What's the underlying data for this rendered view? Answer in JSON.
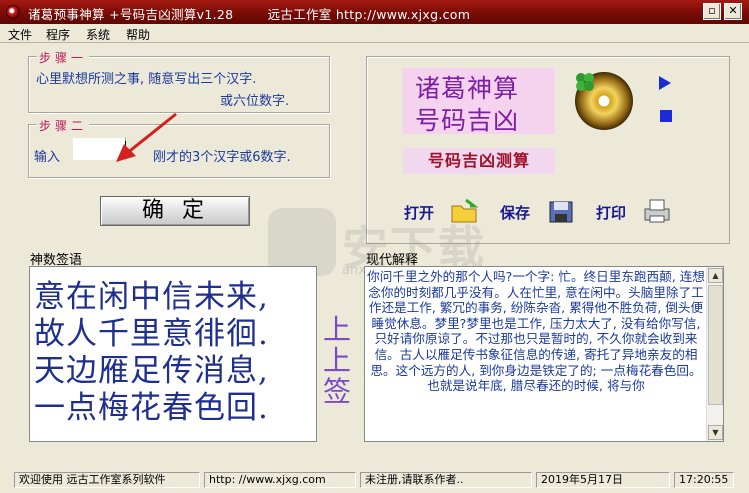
{
  "window": {
    "title": "诸葛预事神算 +号码吉凶测算v1.28        远古工作室 http://www.xjxg.com",
    "min_label": "▫",
    "close_label": "✕"
  },
  "menu": [
    "文件",
    "程序",
    "系统",
    "帮助"
  ],
  "step1": {
    "legend": "步骤一",
    "line1": "心里默想所测之事, 随意写出三个汉字.",
    "line2": "或六位数字."
  },
  "step2": {
    "legend": "步骤二",
    "input_label": "输入",
    "input_value": "",
    "hint": "刚才的3个汉字或6数字."
  },
  "ok_button": "确定",
  "logo": {
    "line1": "诸葛神算",
    "line2": "号码吉凶"
  },
  "sub_title": "号码吉凶测算",
  "tools": {
    "open": "打开",
    "save": "保存",
    "print": "打印"
  },
  "poem": {
    "label": "神数签语",
    "lines": [
      "意在闲中信未来,",
      "故人千里意徘徊.",
      "天边雁足传消息,",
      "一点梅花春色回."
    ],
    "lot": [
      "上",
      "上",
      "签"
    ]
  },
  "explanation": {
    "label": "现代解释",
    "text": "你问千里之外的那个人吗?一个字: 忙。终日里东跑西颠, 连想念你的时刻都几乎没有。人在忙里, 意在闲中。头脑里除了工作还是工作, 繁冗的事务, 纷陈杂沓, 累得他不胜负荷, 倒头便睡觉休息。梦里?梦里也是工作, 压力太大了, 没有给你写信, 只好请你原谅了。不过那也只是暂时的, 不久你就会收到来信。古人以雁足传书象征信息的传递, 寄托了异地亲友的相思。这个远方的人, 到你身边是铁定了的; 一点梅花春色回。也就是说年底, 腊尽春还的时候, 将与你"
  },
  "status": {
    "welcome": "欢迎使用  远古工作室系列软件",
    "url": "http: //www.xjxg.com",
    "register": "未注册,请联系作者..",
    "date": "2019年5月17日",
    "time": "17:20:55"
  },
  "watermark": {
    "text": "安下载",
    "sub": "anxz.com"
  },
  "colors": {
    "title_bar": "#8b0f08",
    "text_blue": "#1a3a9c",
    "poem_blue": "#1e2f8e",
    "lot_purple": "#7b4bc7",
    "legend_red": "#c2185b"
  }
}
